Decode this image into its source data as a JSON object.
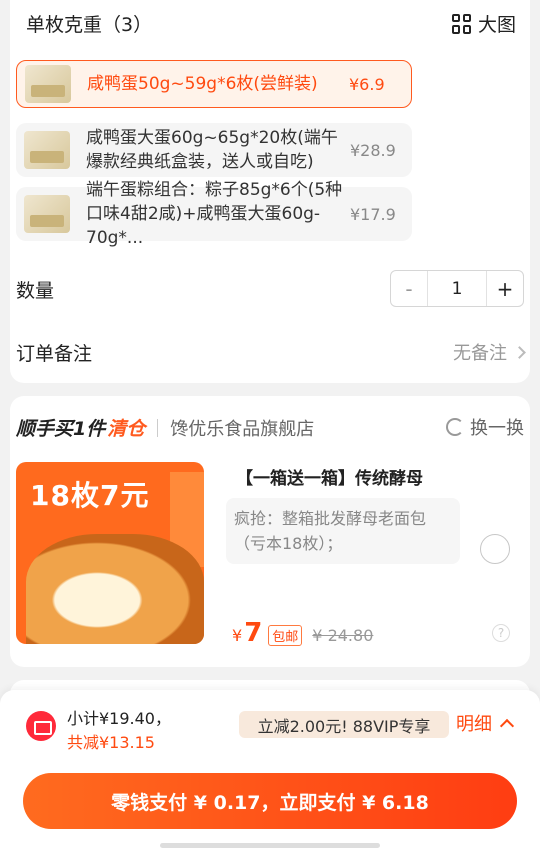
{
  "spec": {
    "title": "单枚克重（3）",
    "bigview_label": "大图",
    "options": [
      {
        "name": "咸鸭蛋50g~59g*6枚(尝鲜装)",
        "price": "¥6.9",
        "selected": true
      },
      {
        "name": "咸鸭蛋大蛋60g~65g*20枚(端午爆款经典纸盒装，送人或自吃)",
        "price": "¥28.9",
        "selected": false
      },
      {
        "name": "端午蛋粽组合：粽子85g*6个(5种口味4甜2咸)+咸鸭蛋大蛋60g-70g*...",
        "price": "¥17.9",
        "selected": false
      }
    ]
  },
  "quantity": {
    "label": "数量",
    "minus": "-",
    "value": "1",
    "plus": "+"
  },
  "remark": {
    "label": "订单备注",
    "value": "无备注"
  },
  "addon": {
    "title_part1": "顺手买1件",
    "title_part2": "清仓",
    "shop": "馋优乐食品旗舰店",
    "swap_label": "换一换",
    "product": {
      "image_banner": "18枚7元",
      "title": "【一箱送一箱】传统酵母",
      "desc": "疯抢：整箱批发酵母老面包（亏本18枚）；",
      "currency": "¥",
      "price": "7",
      "tag": "包邮",
      "orig_price": "¥ 24.80",
      "help": "?"
    }
  },
  "footer": {
    "subtotal": "小计¥19.40，",
    "saved": "共减¥13.15",
    "vip": "立减2.00元! 88VIP专享",
    "detail": "明细",
    "pay_button": "零钱支付 ¥ 0.17，立即支付 ¥ 6.18"
  },
  "colors": {
    "accent": "#ff4a10",
    "selected_bg": "#fff3ea"
  }
}
